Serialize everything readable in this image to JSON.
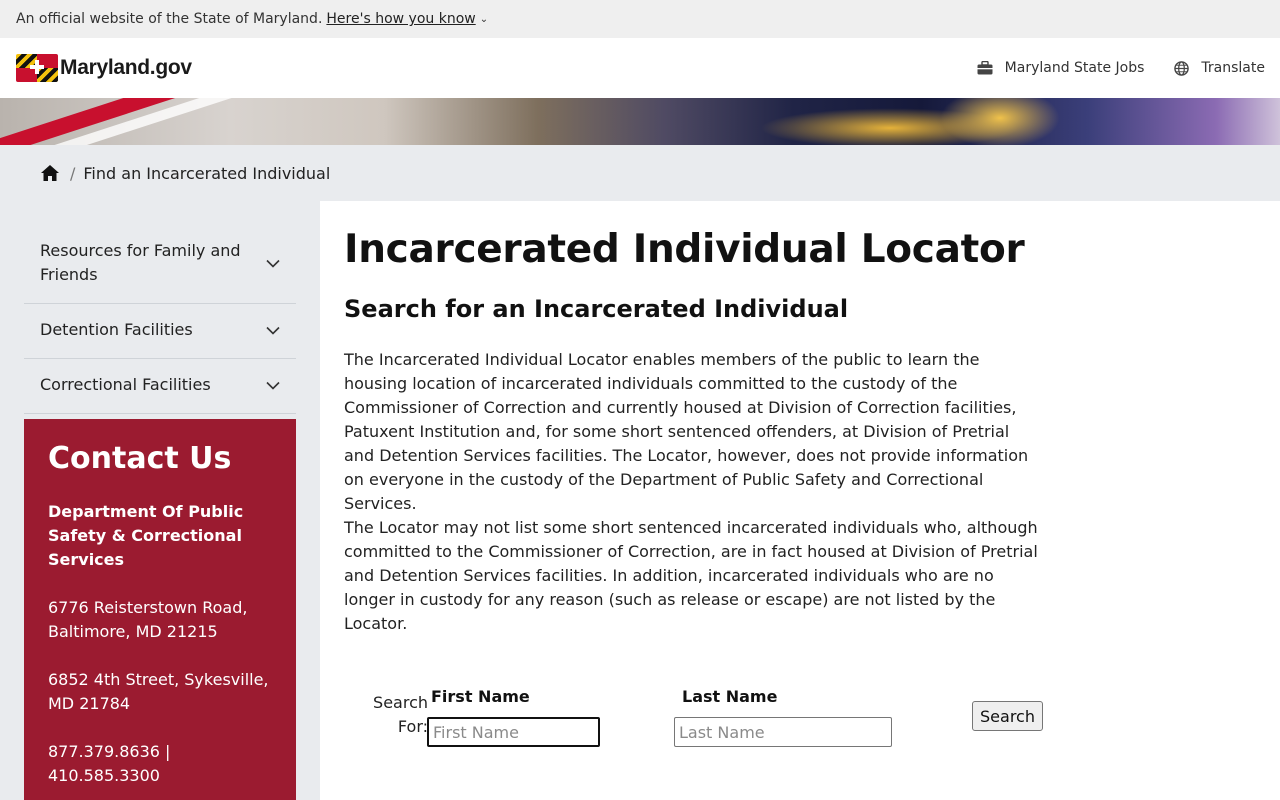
{
  "official_bar": {
    "text": "An official website of the State of Maryland.",
    "link": "Here's how you know"
  },
  "header": {
    "logo_text": "Maryland.gov",
    "links": [
      {
        "label": "Maryland State Jobs",
        "icon": "briefcase-icon"
      },
      {
        "label": "Translate",
        "icon": "globe-icon"
      }
    ]
  },
  "breadcrumb": {
    "home_icon": "home-icon",
    "current": "Find an Incarcerated Individual"
  },
  "sidebar": {
    "items": [
      {
        "label": "Resources for Family and Friends"
      },
      {
        "label": "Detention Facilities"
      },
      {
        "label": "Correctional Facilities"
      }
    ]
  },
  "contact": {
    "title": "Contact Us",
    "dept": "Department Of Public Safety & Correctional Services",
    "addresses": [
      "6776 Reisterstown Road, Baltimore, MD 21215",
      "6852 4th Street, Sykesville, MD 21784"
    ],
    "phones": "877.379.8636 | 410.585.3300"
  },
  "main": {
    "title": "Incarcerated Individual Locator",
    "subtitle": "Search for an Incarcerated Individual",
    "paragraphs": [
      "The Incarcerated Individual Locator enables members of the public to learn the housing location of incarcerated individuals committed to the custody of the Commissioner of Correction and currently housed at Division of Correction facilities, Patuxent Institution and, for some short sentenced offenders, at Division of Pretrial and Detention Services facilities. The Locator, however, does not provide information on everyone in the custody of the Department of Public Safety and Correctional Services.",
      "The Locator may not list some short sentenced incarcerated individuals who, although committed to the Commissioner of Correction, are in fact housed at Division of Pretrial and Detention Services facilities. In addition, incarcerated individuals who are no longer in custody for any reason (such as release or escape) are not listed by the Locator."
    ]
  },
  "search_form": {
    "search_for_label": "Search For:",
    "first_name_label": "First Name",
    "first_name_placeholder": "First Name",
    "first_name_value": "",
    "last_name_label": "Last Name",
    "last_name_placeholder": "Last Name",
    "last_name_value": "",
    "button_label": "Search"
  },
  "colors": {
    "contact_bg": "#9b1b30",
    "gray_bg": "#e9ebee",
    "official_bar_bg": "#efefef"
  }
}
